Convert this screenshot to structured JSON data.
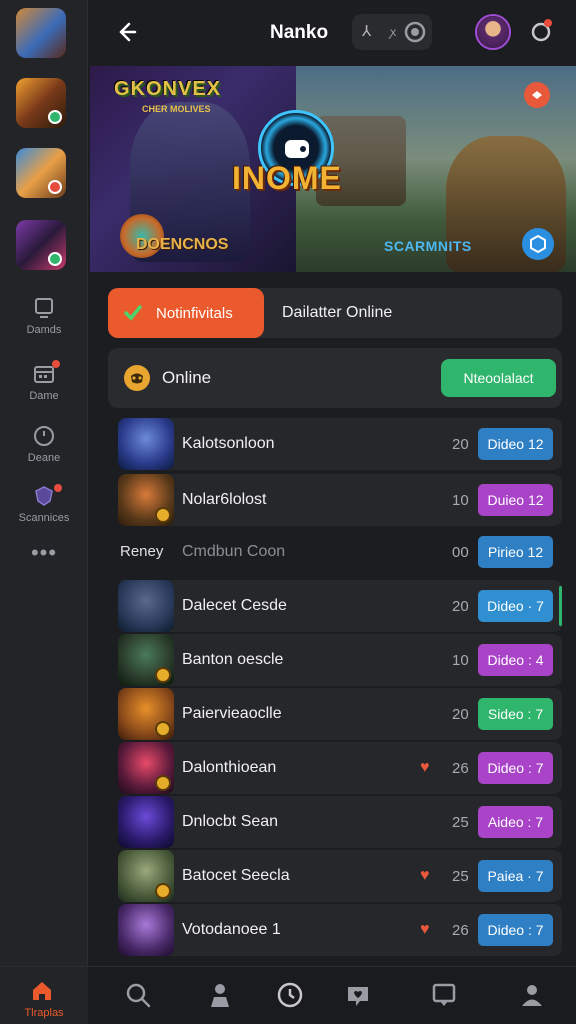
{
  "header": {
    "title": "Nanko",
    "pill_a": "⅄",
    "pill_b": "ꭗ"
  },
  "sidebar": {
    "nav": [
      {
        "label": "Damds",
        "icon": "monitor-icon"
      },
      {
        "label": "Dame",
        "icon": "calendar-icon"
      },
      {
        "label": "Deane",
        "icon": "clock-icon"
      },
      {
        "label": "Scannices",
        "icon": "shield-icon"
      }
    ],
    "more": "•••"
  },
  "banner": {
    "logo_text": "GKONVEX",
    "logo_sub": "CHER MOLIVES",
    "title": "INOME",
    "subtitle": "DOENCNOS",
    "right_label": "SCARMNITS"
  },
  "tabs": {
    "active": "Notinfivitals",
    "other": "Dailatter Online"
  },
  "online": {
    "label": "Online",
    "button": "Nteoolalact"
  },
  "list": [
    {
      "name": "Kalotsonloon",
      "count": "20",
      "tag": "Dideo 12",
      "tag_color": "#2f7fc4",
      "heart": false
    },
    {
      "name": "Nolar6lolost",
      "count": "10",
      "tag": "Duieo 12",
      "tag_color": "#a943c8",
      "heart": false
    },
    {
      "prefix": "Reney",
      "name": "Cmdbun Coon",
      "count": "00",
      "tag": "Pirieo 12",
      "tag_color": "#2f7fc4",
      "heart": false,
      "plain": true
    },
    {
      "name": "Dalecet Cesde",
      "count": "20",
      "tag": "Dideo · 7",
      "tag_color": "#2f8fd0",
      "heart": false,
      "accent": true
    },
    {
      "name": "Banton oescle",
      "count": "10",
      "tag": "Dideo : 4",
      "tag_color": "#a943c8",
      "heart": false
    },
    {
      "name": "Paiervieaoclle",
      "count": "20",
      "tag": "Sideo : 7",
      "tag_color": "#2fb56c",
      "heart": false
    },
    {
      "name": "Dalonthioean",
      "count": "26",
      "tag": "Dideo : 7",
      "tag_color": "#a943c8",
      "heart": true
    },
    {
      "name": "Dnlocbt Sean",
      "count": "25",
      "tag": "Aideo : 7",
      "tag_color": "#a943c8",
      "heart": false
    },
    {
      "name": "Batocet Seecla",
      "count": "25",
      "tag": "Paiea · 7",
      "tag_color": "#2f7fc4",
      "heart": true
    },
    {
      "name": "Votodanoee 1",
      "count": "26",
      "tag": "Dideo : 7",
      "tag_color": "#2f7fc4",
      "heart": true
    }
  ],
  "bottom_nav": {
    "home_label": "Tlraplas"
  }
}
